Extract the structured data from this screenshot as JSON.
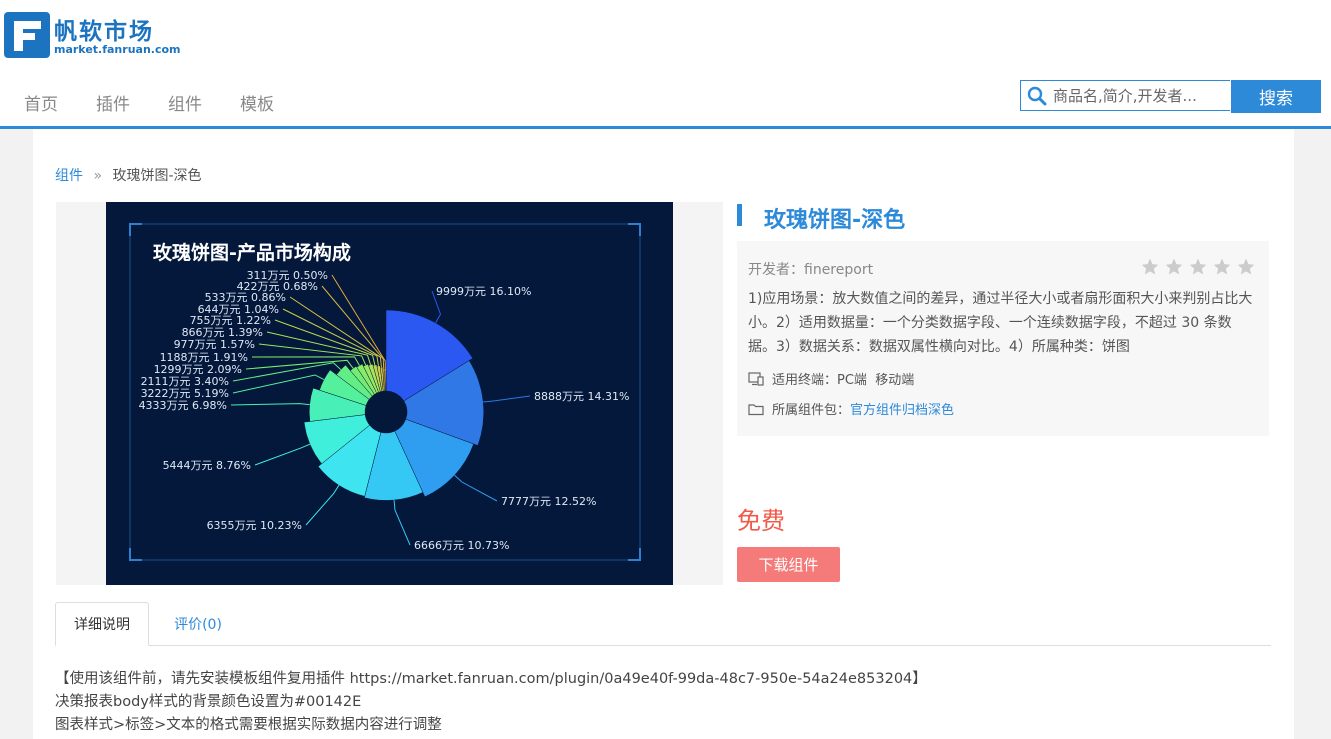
{
  "site": {
    "logo_cn": "帆软市场",
    "logo_en": "market.fanruan.com"
  },
  "nav": [
    {
      "label": "首页"
    },
    {
      "label": "插件"
    },
    {
      "label": "组件"
    },
    {
      "label": "模板"
    }
  ],
  "search": {
    "placeholder": "商品名,简介,开发者...",
    "button": "搜索"
  },
  "breadcrumb": {
    "link": "组件",
    "separator": "»",
    "current": "玫瑰饼图-深色"
  },
  "product": {
    "title": "玫瑰饼图-深色",
    "developer": "开发者：finereport",
    "rating": 0,
    "rating_max": 5,
    "description": "1)应用场景：放大数值之间的差异，通过半径大小或者扇形面积大小来判别占比大小。2）适用数据量：一个分类数据字段、一个连续数据字段，不超过 30 条数据。3）数据关系：数据双属性横向对比。4）所属种类：饼图",
    "terminal_label": "适用终端：",
    "terminal_values": "PC端  移动端",
    "package_label": "所属组件包：",
    "package_link": "官方组件归档深色",
    "price": "免费",
    "download": "下载组件"
  },
  "tabs": [
    {
      "label": "详细说明",
      "active": true
    },
    {
      "label": "评价(0)",
      "active": false
    }
  ],
  "details": [
    "【使用该组件前，请先安装模板组件复用插件 https://market.fanruan.com/plugin/0a49e40f-99da-48c7-950e-54a24e853204】",
    "决策报表body样式的背景颜色设置为#00142E",
    "图表样式>标签>文本的格式需要根据实际数据内容进行调整"
  ],
  "colors": {
    "accent": "#2d8ad9",
    "price": "#f05a4a",
    "download": "#f47b7a",
    "chart_bg": "#03183a"
  },
  "chart_data": {
    "type": "pie",
    "variant": "rose",
    "title": "玫瑰饼图-产品市场构成",
    "categories": [
      "9999万元",
      "8888万元",
      "7777万元",
      "6666万元",
      "6355万元",
      "5444万元",
      "4333万元",
      "3222万元",
      "2111万元",
      "1299万元",
      "1188万元",
      "977万元",
      "866万元",
      "755万元",
      "644万元",
      "533万元",
      "422万元",
      "311万元"
    ],
    "values": [
      9999,
      8888,
      7777,
      6666,
      6355,
      5444,
      4333,
      3222,
      2111,
      1299,
      1188,
      977,
      866,
      755,
      644,
      533,
      422,
      311
    ],
    "percent_labels": [
      "16.10%",
      "14.31%",
      "12.52%",
      "10.73%",
      "10.23%",
      "8.76%",
      "6.98%",
      "5.19%",
      "3.40%",
      "2.09%",
      "1.91%",
      "1.57%",
      "1.39%",
      "1.22%",
      "1.04%",
      "0.86%",
      "0.68%",
      "0.50%"
    ],
    "colors": [
      "#2a58f0",
      "#2f78e6",
      "#2f9ef0",
      "#36c8f4",
      "#3ee4f0",
      "#40eedc",
      "#48f0b8",
      "#55f09c",
      "#62ee84",
      "#74ec74",
      "#86ea6a",
      "#98e862",
      "#aae25a",
      "#bcd852",
      "#ccd04a",
      "#d6c444",
      "#dcb640",
      "#e2a83e"
    ]
  }
}
